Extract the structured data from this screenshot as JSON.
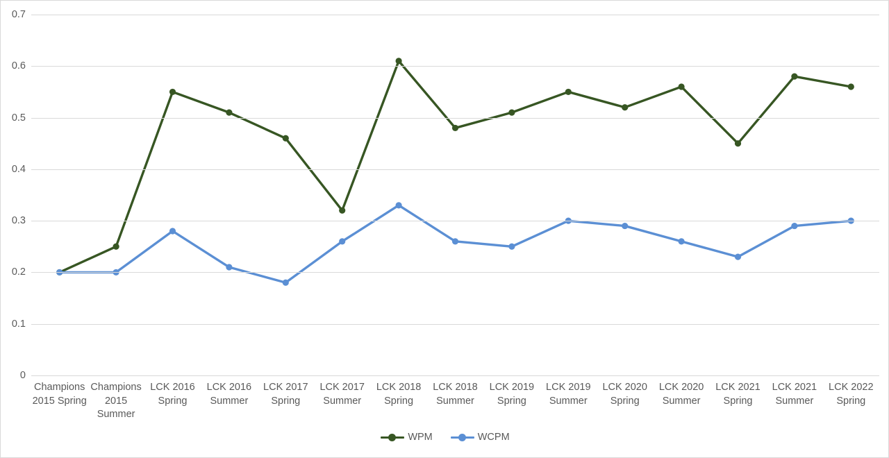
{
  "chart_data": {
    "type": "line",
    "title": "",
    "subtitle": "",
    "xlabel": "",
    "ylabel": "",
    "ylim": [
      0,
      0.7
    ],
    "grid": true,
    "legend_position": "bottom",
    "ytick_labels": [
      "0.7",
      "0.6",
      "0.5",
      "0.4",
      "0.3",
      "0.2",
      "0.1",
      "0"
    ],
    "ytick_values": [
      0.7,
      0.6,
      0.5,
      0.4,
      0.3,
      0.2,
      0.1,
      0
    ],
    "categories": [
      "Champions 2015 Spring",
      "Champions 2015 Summer",
      "LCK 2016 Spring",
      "LCK 2016 Summer",
      "LCK 2017 Spring",
      "LCK 2017 Summer",
      "LCK 2018 Spring",
      "LCK 2018 Summer",
      "LCK 2019 Spring",
      "LCK 2019 Summer",
      "LCK 2020 Spring",
      "LCK 2020 Summer",
      "LCK 2021 Spring",
      "LCK 2021 Summer",
      "LCK 2022 Spring"
    ],
    "series": [
      {
        "name": "WPM",
        "color": "#375623",
        "values": [
          0.2,
          0.25,
          0.55,
          0.51,
          0.46,
          0.32,
          0.61,
          0.48,
          0.51,
          0.55,
          0.52,
          0.56,
          0.45,
          0.58,
          0.56
        ]
      },
      {
        "name": "WCPM",
        "color": "#5b8fd4",
        "values": [
          0.2,
          0.2,
          0.28,
          0.21,
          0.18,
          0.26,
          0.33,
          0.26,
          0.25,
          0.3,
          0.29,
          0.26,
          0.23,
          0.29,
          0.3
        ]
      }
    ]
  },
  "legend": {
    "entries": [
      {
        "label": "WPM",
        "color": "#375623"
      },
      {
        "label": "WCPM",
        "color": "#5b8fd4"
      }
    ]
  },
  "colors": {
    "gridline": "#d9d9d9",
    "text": "#595959",
    "border": "#d9d9d9",
    "background": "#ffffff"
  }
}
